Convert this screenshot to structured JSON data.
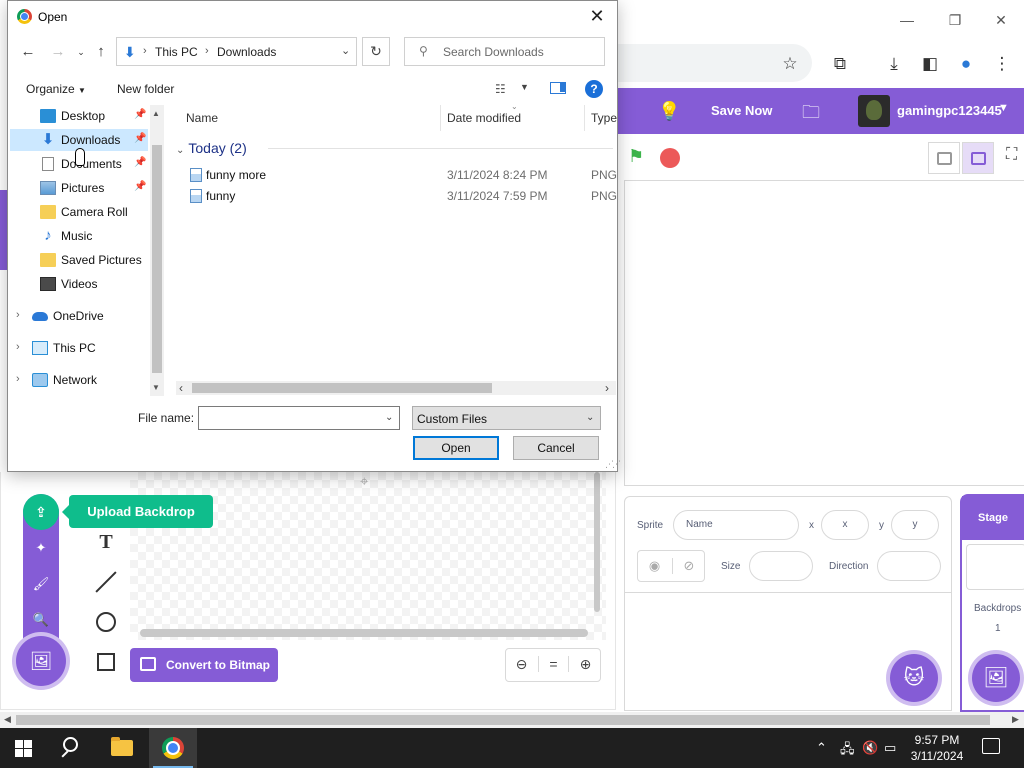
{
  "dialog": {
    "title": "Open",
    "breadcrumb": [
      "This PC",
      "Downloads"
    ],
    "search_placeholder": "Search Downloads",
    "organize_label": "Organize",
    "new_folder_label": "New folder",
    "help_label": "?",
    "nav_items": [
      {
        "label": "Desktop",
        "icon": "desktop-icon",
        "pinned": true
      },
      {
        "label": "Downloads",
        "icon": "download-arrow-icon",
        "pinned": true,
        "selected": true
      },
      {
        "label": "Documents",
        "icon": "document-icon",
        "pinned": true
      },
      {
        "label": "Pictures",
        "icon": "pictures-icon",
        "pinned": true
      },
      {
        "label": "Camera Roll",
        "icon": "folder-icon"
      },
      {
        "label": "Music",
        "icon": "music-icon"
      },
      {
        "label": "Saved Pictures",
        "icon": "folder-icon"
      },
      {
        "label": "Videos",
        "icon": "video-icon"
      },
      {
        "label": "OneDrive",
        "icon": "cloud-icon",
        "expandable": true
      },
      {
        "label": "This PC",
        "icon": "computer-icon",
        "expandable": true
      },
      {
        "label": "Network",
        "icon": "network-icon",
        "expandable": true
      }
    ],
    "columns": {
      "name": "Name",
      "date": "Date modified",
      "type": "Type"
    },
    "group": {
      "label": "Today (2)"
    },
    "files": [
      {
        "name": "funny more",
        "date": "3/11/2024 8:24 PM",
        "type": "PNG"
      },
      {
        "name": "funny",
        "date": "3/11/2024 7:59 PM",
        "type": "PNG"
      }
    ],
    "file_name_label": "File name:",
    "file_name_value": "",
    "file_type": "Custom Files",
    "open_label": "Open",
    "cancel_label": "Cancel"
  },
  "app": {
    "save_now": "Save Now",
    "username": "gamingpc123445",
    "sprite": {
      "label": "Sprite",
      "name_placeholder": "Name",
      "x_label": "x",
      "x_placeholder": "x",
      "y_label": "y",
      "y_placeholder": "y",
      "size_label": "Size",
      "direction_label": "Direction"
    },
    "stage": {
      "label": "Stage",
      "backdrops_label": "Backdrops",
      "backdrops_count": "1"
    },
    "upload_tooltip": "Upload Backdrop",
    "convert_label": "Convert to Bitmap",
    "accent": "#855cd6",
    "upload_color": "#0fbd8c"
  },
  "taskbar": {
    "time": "9:57 PM",
    "date": "3/11/2024"
  }
}
